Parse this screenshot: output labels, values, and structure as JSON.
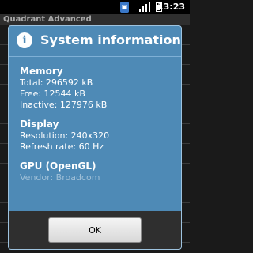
{
  "status_bar": {
    "time": "13:23",
    "icons": [
      "sim-card-icon",
      "signal-icon",
      "battery-icon"
    ]
  },
  "app": {
    "title": "Quadrant Advanced"
  },
  "dialog": {
    "title": "System information",
    "icon": "info-icon",
    "sections": [
      {
        "title": "Memory",
        "lines": [
          "Total: 296592 kB",
          "Free: 12544 kB",
          "Inactive: 127976 kB"
        ]
      },
      {
        "title": "Display",
        "lines": [
          "Resolution: 240x320",
          "Refresh rate: 60 Hz"
        ]
      },
      {
        "title": "GPU (OpenGL)",
        "lines": [
          "Vendor: Broadcom"
        ]
      }
    ],
    "ok_label": "OK"
  },
  "colors": {
    "dialog_bg": "#4e8ab6",
    "footer_bg": "#2f2f2f"
  }
}
